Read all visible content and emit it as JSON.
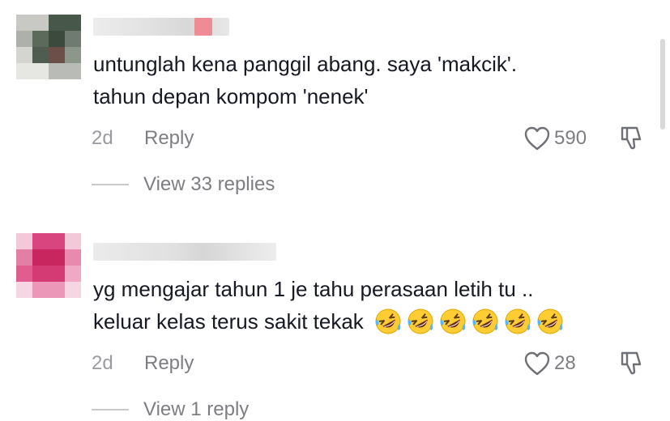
{
  "comments": [
    {
      "lines": [
        "untunglah kena panggil abang. saya 'makcik'.",
        "tahun depan kompom 'nenek'"
      ],
      "time": "2d",
      "reply_label": "Reply",
      "likes": "590",
      "view_replies": "View 33 replies"
    },
    {
      "lines": [
        "yg mengajar tahun 1 je tahu perasaan letih tu ..",
        "keluar kelas terus sakit tekak"
      ],
      "emoji_count": 6,
      "emoji_icon": "rolling-on-floor-laughing-emoji",
      "time": "2d",
      "reply_label": "Reply",
      "likes": "28",
      "view_replies": "View 1 reply"
    }
  ],
  "colors": {
    "text": "#161823",
    "muted": "#7d7e83",
    "avatar1": [
      "#5a6b5a",
      "#8a8f87",
      "#3e4a3e",
      "#b7b9b2"
    ],
    "avatar2": [
      "#d63c78",
      "#e57aa2",
      "#f1b4cb",
      "#c8245f"
    ]
  }
}
